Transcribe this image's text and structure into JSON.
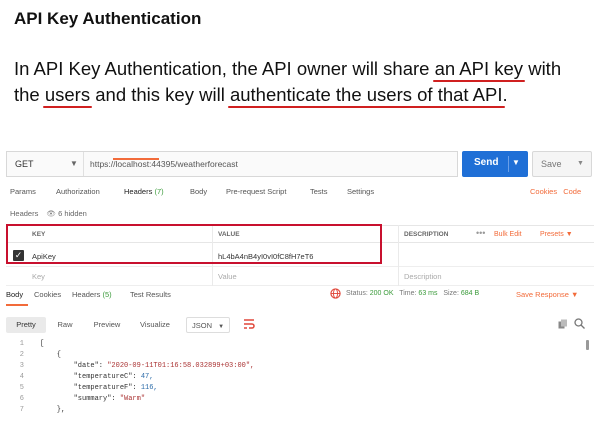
{
  "slide": {
    "title": "API Key Authentication",
    "line1_a": "In API Key Authentication, the API owner will share ",
    "line1_u": "an API key",
    "line1_b": " with",
    "line2_a": "the ",
    "line2_u1": "users",
    "line2_b": " and this key will ",
    "line2_u2": "authenticate the users of that API",
    "line2_c": ".",
    "underline_color": "#d02020"
  },
  "request": {
    "method": "GET",
    "url": "https://localhost:44395/weatherforecast",
    "send_label": "Send",
    "save_label": "Save",
    "send_color": "#1f6fd6"
  },
  "tabs": {
    "params": "Params",
    "authorization": "Authorization",
    "headers": "Headers",
    "headers_count": "(7)",
    "body": "Body",
    "prerequest": "Pre-request Script",
    "tests": "Tests",
    "settings": "Settings",
    "cookies": "Cookies",
    "code": "Code",
    "accent": "#f26b3a"
  },
  "headers_section": {
    "label": "Headers",
    "hidden": "6 hidden"
  },
  "table": {
    "col_key": "KEY",
    "col_value": "VALUE",
    "col_description": "DESCRIPTION",
    "more": "•••",
    "bulk_edit": "Bulk Edit",
    "presets": "Presets",
    "row_key": "ApiKey",
    "row_value": "hL4bA4nB4yI0vI0fC8fH7eT6",
    "placeholder_key": "Key",
    "placeholder_value": "Value",
    "placeholder_description": "Description",
    "highlight_color": "#c8102e"
  },
  "response": {
    "body": "Body",
    "cookies": "Cookies",
    "headers": "Headers",
    "headers_count": "(5)",
    "test_results": "Test Results",
    "status_label": "Status:",
    "status_value": "200 OK",
    "time_label": "Time:",
    "time_value": "63 ms",
    "size_label": "Size:",
    "size_value": "684 B",
    "save_response": "Save Response"
  },
  "viewer": {
    "pretty": "Pretty",
    "raw": "Raw",
    "preview": "Preview",
    "visualize": "Visualize",
    "format": "JSON"
  },
  "code": {
    "line_numbers": [
      "1",
      "2",
      "3",
      "4",
      "5",
      "6",
      "7"
    ],
    "l1": "[",
    "l2": "    {",
    "l3_key": "        \"date\": ",
    "l3_val": "\"2020-09-11T01:16:58.032899+03:00\",",
    "l4_key": "        \"temperatureC\": ",
    "l4_val": "47,",
    "l5_key": "        \"temperatureF\": ",
    "l5_val": "116,",
    "l6_key": "        \"summary\": ",
    "l6_val": "\"Warm\"",
    "l7": "    },"
  }
}
